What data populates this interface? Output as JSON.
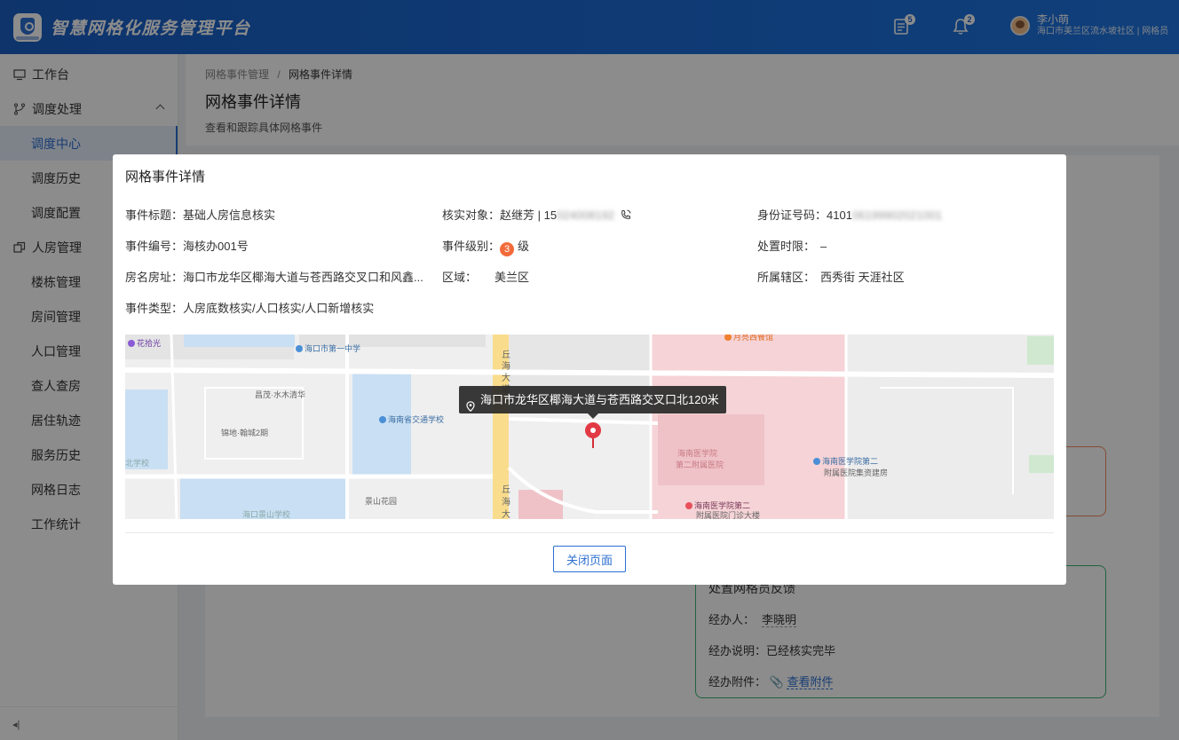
{
  "header": {
    "app_title": "智慧网格化服务管理平台",
    "task_badge": "5",
    "bell_badge": "2",
    "user_name": "李小萌",
    "user_org": "海口市美兰区流水坡社区 | 网格员"
  },
  "sidebar": {
    "items": [
      {
        "label": "工作台"
      },
      {
        "label": "调度处理"
      },
      {
        "label": "调度中心"
      },
      {
        "label": "调度历史"
      },
      {
        "label": "调度配置"
      },
      {
        "label": "人房管理"
      },
      {
        "label": "楼栋管理"
      },
      {
        "label": "房间管理"
      },
      {
        "label": "人口管理"
      },
      {
        "label": "查人查房"
      },
      {
        "label": "居住轨迹"
      },
      {
        "label": "服务历史"
      },
      {
        "label": "网格日志"
      },
      {
        "label": "工作统计"
      }
    ],
    "collapse_glyph": "◂|"
  },
  "page": {
    "breadcrumb_parent": "网格事件管理",
    "breadcrumb_sep": "/",
    "breadcrumb_current": "网格事件详情",
    "title": "网格事件详情",
    "description": "查看和跟踪具体网格事件"
  },
  "handler_card": {
    "title": "处置网格员反馈",
    "handler_label": "经办人：",
    "handler_value": "李晓明",
    "note_label": "经办说明：",
    "note_value": "已经核实完毕",
    "attach_label": "经办附件：",
    "attach_link": "查看附件"
  },
  "modal": {
    "title": "网格事件详情",
    "fields": {
      "event_title_label": "事件标题：",
      "event_title_value": "基础人房信息核实",
      "target_label": "核实对象：",
      "target_name": "赵继芳 | 15",
      "target_phone_masked": "024008192",
      "id_label": "身份证号码：",
      "id_prefix": "4101",
      "id_masked": "06199902021001",
      "event_no_label": "事件编号：",
      "event_no_value": "海核办001号",
      "level_label": "事件级别：",
      "level_value": "3",
      "level_unit": "级",
      "deadline_label": "处置时限：",
      "deadline_value": "–",
      "address_label": "房名房址：",
      "address_value": "海口市龙华区椰海大道与苍西路交叉口和风鑫...",
      "region_label": "区域：",
      "region_value": "美兰区",
      "district_label": "所属辖区：",
      "district_value": "西秀街 天涯社区",
      "type_label": "事件类型：",
      "type_value": "人房底数核实/人口核实/人口新增核实"
    },
    "map": {
      "tooltip": "海口市龙华区椰海大道与苍西路交叉口北120米",
      "labels": {
        "huashiguang": "花拾光",
        "school1": "海口市第一中学",
        "road_qiu1": "丘",
        "road_hai1": "海",
        "road_da1": "大",
        "road_dao1": "道",
        "road_qiu2": "丘",
        "road_hai2": "海",
        "road_da2": "大",
        "community1": "昌茂·水木清华",
        "community2": "锦地·翰城2期",
        "traffic_school": "海南省交通学校",
        "hospital": "海南医学院",
        "hospital2": "第二附属医院",
        "hosp_build": "海南医学院第二",
        "hosp_build2": "附属医院集资建房",
        "hosp_clinic": "海南医学院第二",
        "hosp_clinic2": "附属医院门诊大楼",
        "jingshan": "景山花园",
        "jingshan_school": "海口景山学校",
        "north_school": "北学校",
        "restaurant": "月亮西餐馆"
      }
    },
    "close_button": "关闭页面"
  }
}
